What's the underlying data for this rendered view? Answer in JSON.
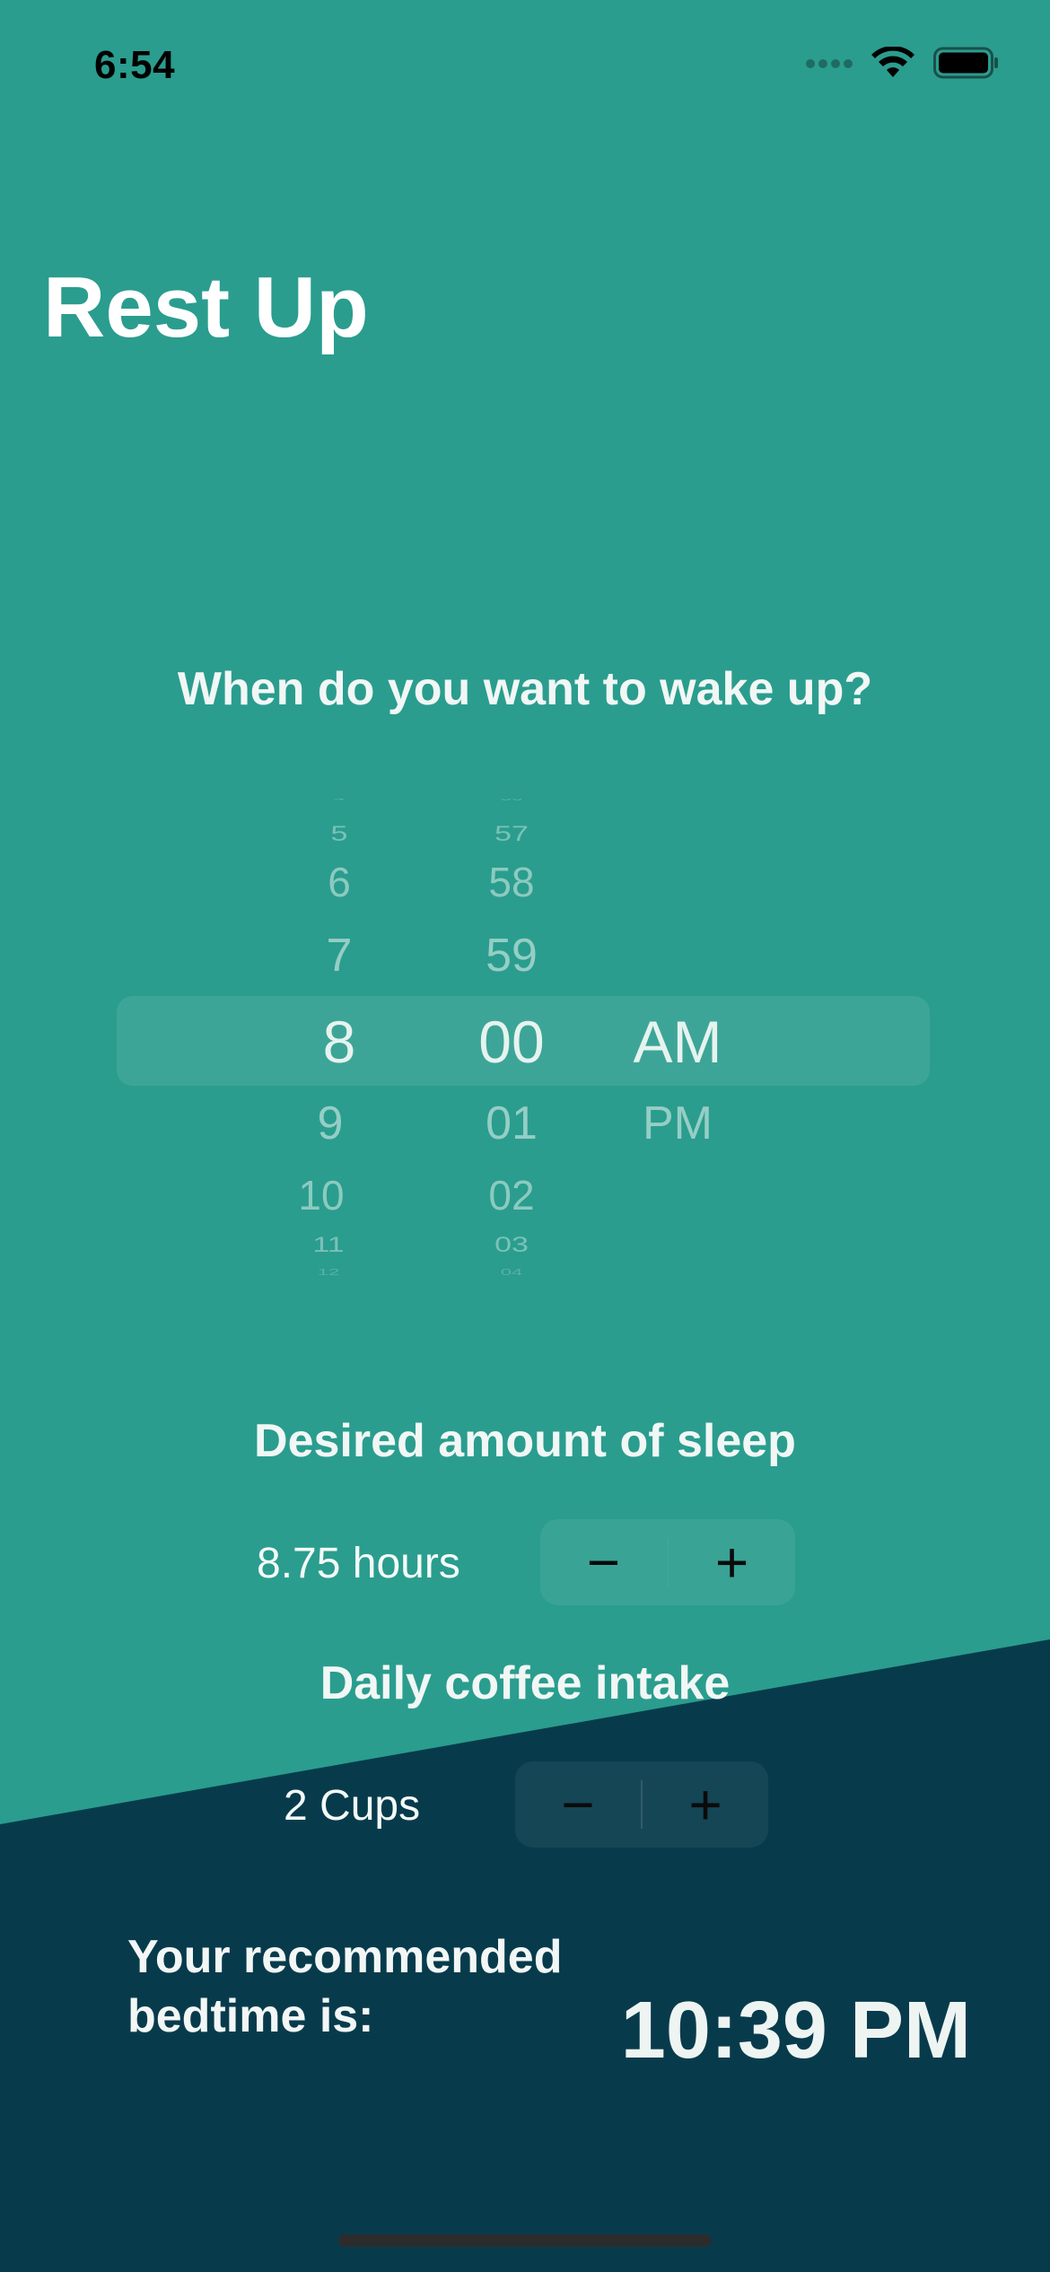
{
  "status_bar": {
    "time": "6:54"
  },
  "app": {
    "title": "Rest Up"
  },
  "wake_section": {
    "question": "When do you want to wake up?",
    "picker": {
      "hours": [
        "4",
        "5",
        "6",
        "7",
        "8",
        "9",
        "10",
        "11",
        "12"
      ],
      "minutes": [
        "56",
        "57",
        "58",
        "59",
        "00",
        "01",
        "02",
        "03",
        "04"
      ],
      "periods": [
        "AM",
        "PM"
      ],
      "selected": {
        "hour": "8",
        "minute": "00",
        "period": "AM"
      }
    }
  },
  "sleep_section": {
    "label": "Desired amount of sleep",
    "value": "8.75 hours",
    "decrement": "−",
    "increment": "+"
  },
  "coffee_section": {
    "label": "Daily coffee intake",
    "value": "2 Cups",
    "decrement": "−",
    "increment": "+"
  },
  "result": {
    "label_line1": "Your recommended",
    "label_line2": "bedtime is:",
    "value": "10:39 PM"
  },
  "colors": {
    "teal": "#2A9D8E",
    "dark": "#073B4C",
    "text_light": "#F1F7F5"
  }
}
